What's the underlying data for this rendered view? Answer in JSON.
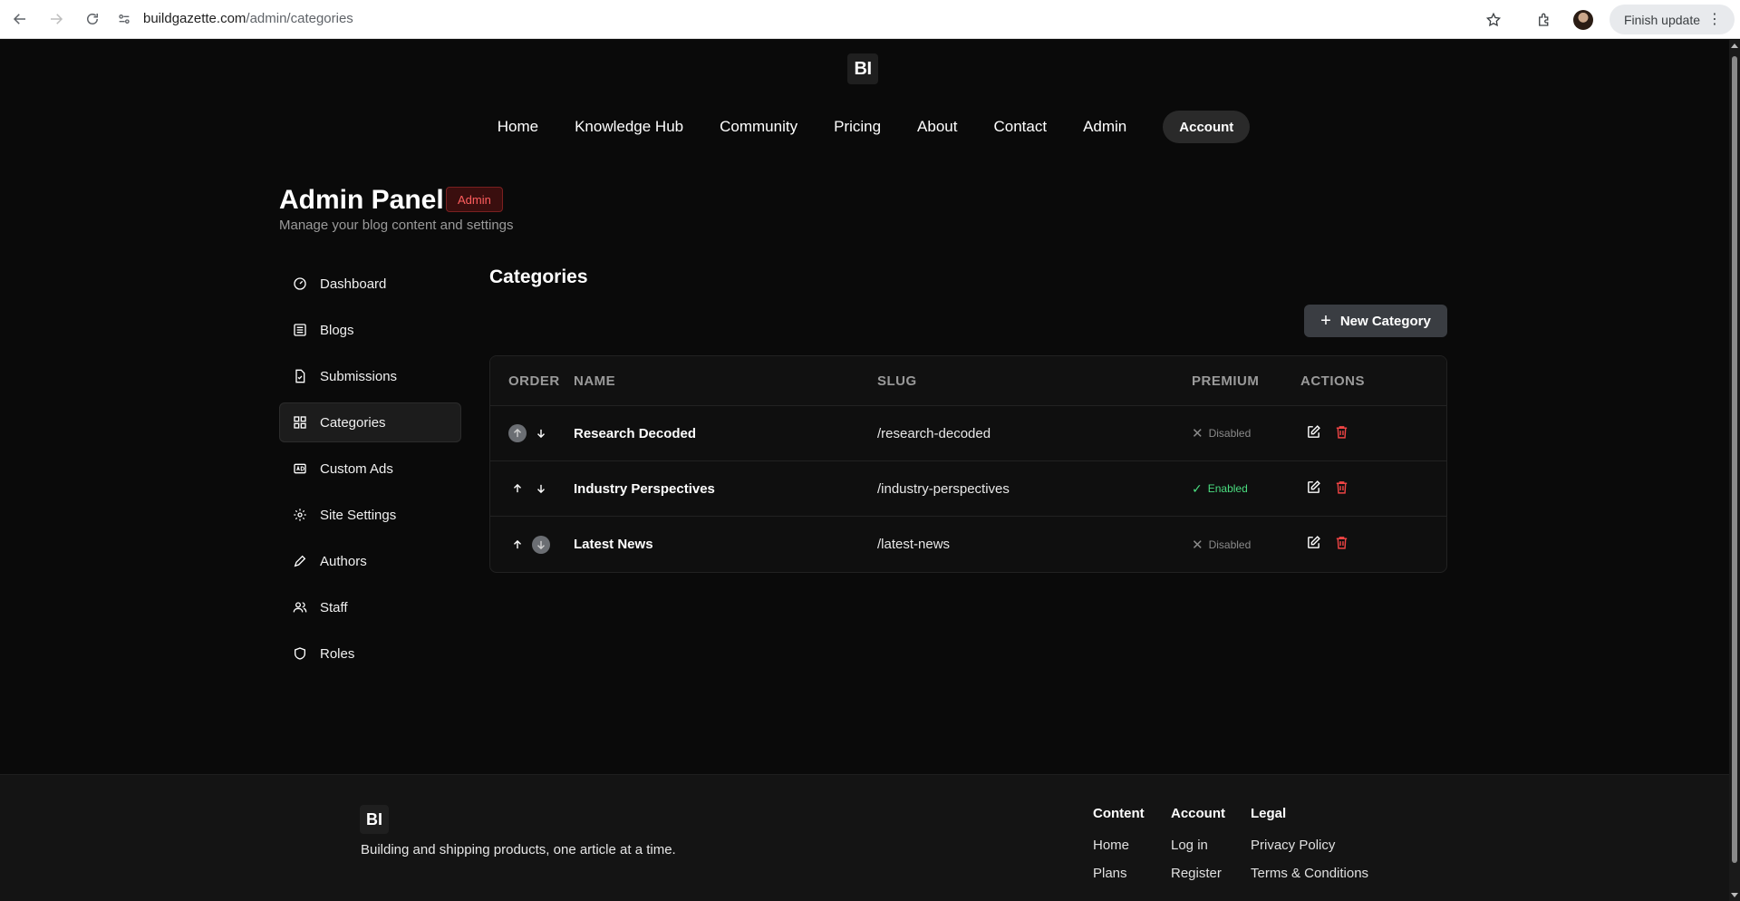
{
  "browser": {
    "url_domain": "buildgazette.com",
    "url_path": "/admin/categories",
    "finish_update": "Finish update"
  },
  "site": {
    "logo": "BI",
    "nav": [
      "Home",
      "Knowledge Hub",
      "Community",
      "Pricing",
      "About",
      "Contact",
      "Admin"
    ],
    "account_label": "Account"
  },
  "page": {
    "title": "Admin Panel",
    "badge": "Admin",
    "subtitle": "Manage your blog content and settings"
  },
  "sidebar": {
    "items": [
      {
        "label": "Dashboard",
        "icon": "gauge-icon"
      },
      {
        "label": "Blogs",
        "icon": "list-icon"
      },
      {
        "label": "Submissions",
        "icon": "file-check-icon"
      },
      {
        "label": "Categories",
        "icon": "grid-icon",
        "active": true
      },
      {
        "label": "Custom Ads",
        "icon": "ad-icon"
      },
      {
        "label": "Site Settings",
        "icon": "gear-icon"
      },
      {
        "label": "Authors",
        "icon": "pen-icon"
      },
      {
        "label": "Staff",
        "icon": "users-icon"
      },
      {
        "label": "Roles",
        "icon": "shield-icon"
      }
    ]
  },
  "categories": {
    "title": "Categories",
    "new_button": "New Category",
    "columns": [
      "ORDER",
      "NAME",
      "SLUG",
      "PREMIUM",
      "ACTIONS"
    ],
    "rows": [
      {
        "name": "Research Decoded",
        "slug": "/research-decoded",
        "premium": "Disabled",
        "enabled": false,
        "up_disabled": true,
        "down_disabled": false
      },
      {
        "name": "Industry Perspectives",
        "slug": "/industry-perspectives",
        "premium": "Enabled",
        "enabled": true,
        "up_disabled": false,
        "down_disabled": false
      },
      {
        "name": "Latest News",
        "slug": "/latest-news",
        "premium": "Disabled",
        "enabled": false,
        "up_disabled": false,
        "down_disabled": true
      }
    ]
  },
  "footer": {
    "tagline": "Building and shipping products, one article at a time.",
    "columns": [
      {
        "heading": "Content",
        "links": [
          "Home",
          "Plans"
        ]
      },
      {
        "heading": "Account",
        "links": [
          "Log in",
          "Register"
        ]
      },
      {
        "heading": "Legal",
        "links": [
          "Privacy Policy",
          "Terms & Conditions"
        ]
      }
    ]
  },
  "colors": {
    "background": "#0a0a0a",
    "danger": "#ef4444",
    "success": "#4ade80"
  }
}
